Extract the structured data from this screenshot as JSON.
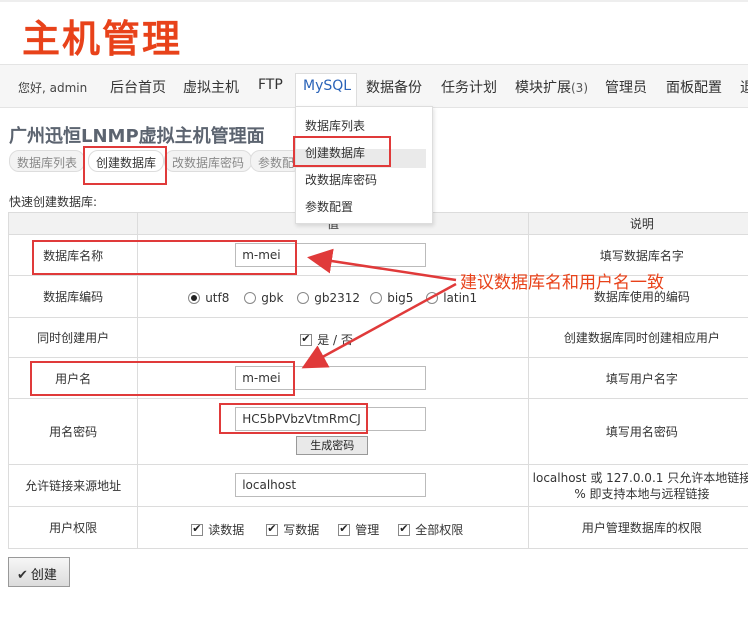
{
  "header": {
    "logo_text": "主机管理"
  },
  "nav": {
    "greeting": "您好, admin",
    "items": [
      "后台首页",
      "虚拟主机",
      "FTP",
      "MySQL",
      "数据备份",
      "任务计划",
      "模块扩展",
      "管理员",
      "面板配置",
      "退"
    ],
    "module_count": "(3)",
    "active": "MySQL"
  },
  "dropdown": {
    "items": [
      "数据库列表",
      "创建数据库",
      "改数据库密码",
      "参数配置"
    ]
  },
  "page": {
    "title": "广州迅恒LNMP虚拟主机管理面",
    "subtabs": [
      "数据库列表",
      "创建数据库",
      "改数据库密码",
      "参数配"
    ],
    "section_label": "快速创建数据库:"
  },
  "table": {
    "headers": [
      "",
      "值",
      "说明"
    ],
    "db_name": {
      "label": "数据库名称",
      "value": "m-mei",
      "desc": "填写数据库名字"
    },
    "db_encoding": {
      "label": "数据库编码",
      "options": [
        "utf8",
        "gbk",
        "gb2312",
        "big5",
        "latin1"
      ],
      "selected": "utf8",
      "desc": "数据库使用的编码"
    },
    "create_user": {
      "label": "同时创建用户",
      "option_text": "是 / 否",
      "checked": true,
      "desc": "创建数据库同时创建相应用户"
    },
    "username": {
      "label": "用户名",
      "value": "m-mei",
      "desc": "填写用户名字"
    },
    "password": {
      "label": "用名密码",
      "value": "HC5bPVbzVtmRmCJ",
      "gen_button": "生成密码",
      "desc": "填写用名密码"
    },
    "allowed_host": {
      "label": "允许链接来源地址",
      "value": "localhost",
      "desc_line1": "localhost 或 127.0.0.1 只允许本地链接",
      "desc_line2": "% 即支持本地与远程链接"
    },
    "privileges": {
      "label": "用户权限",
      "options": [
        "读数据",
        "写数据",
        "管理",
        "全部权限"
      ],
      "desc": "用户管理数据库的权限"
    }
  },
  "create_button": "创建",
  "annotation": {
    "text": "建议数据库名和用户名一致",
    "color": "#e8421a"
  },
  "colors": {
    "accent": "#e8421a",
    "highlight": "#e03a3a",
    "active_tab": "#2a63b8"
  }
}
